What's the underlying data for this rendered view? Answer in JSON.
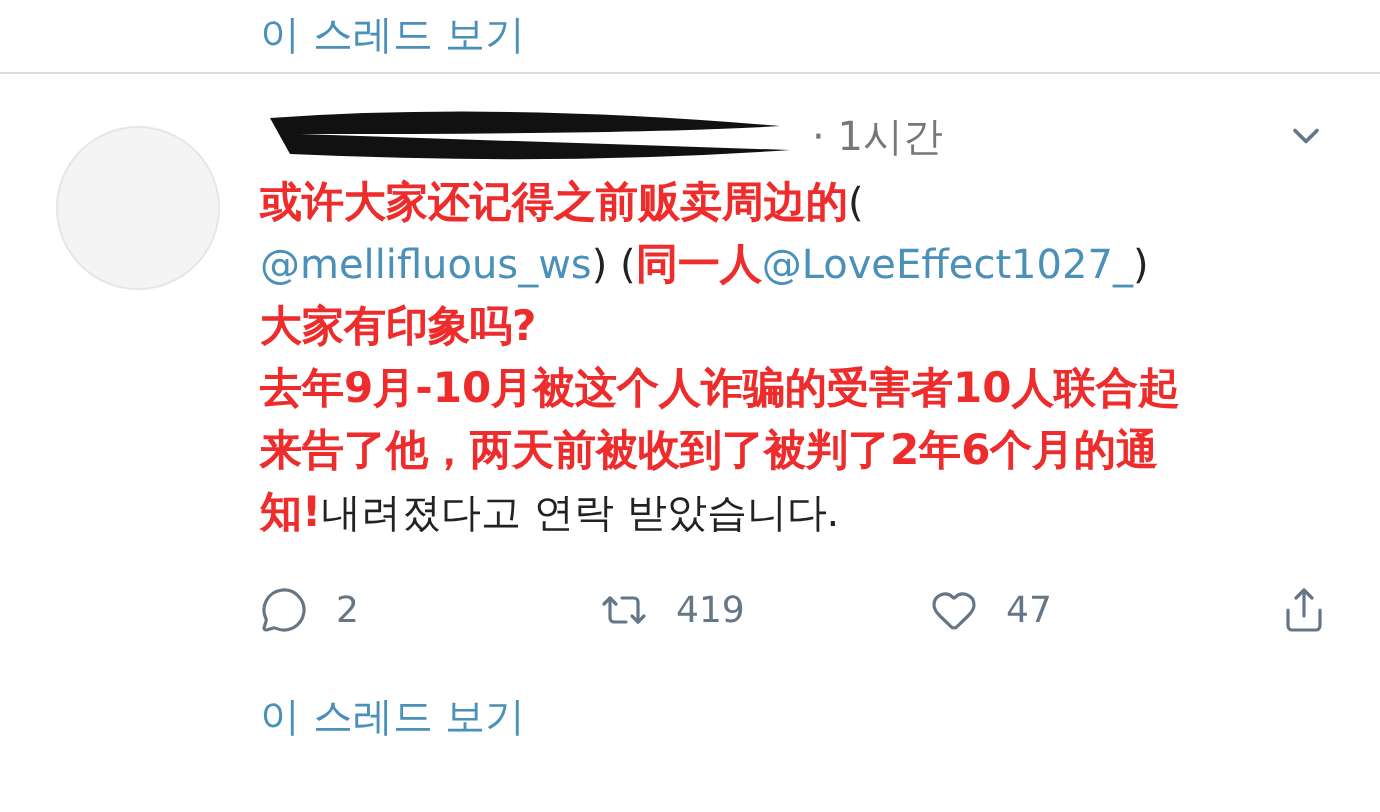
{
  "top_link": "이 스레드 보기",
  "tweet": {
    "header": {
      "time": "· 1시간"
    },
    "lines": [
      [
        {
          "kind": "annotation",
          "text": "或许大家还记得之前贩卖周边的"
        },
        {
          "kind": "text",
          "text": "("
        }
      ],
      [
        {
          "kind": "mention",
          "text": "@mellifluous_ws"
        },
        {
          "kind": "text",
          "text": ") ("
        },
        {
          "kind": "annotation",
          "text": "同一人"
        },
        {
          "kind": "mention",
          "text": "@LoveEffect1027_"
        },
        {
          "kind": "text",
          "text": ")"
        }
      ],
      [
        {
          "kind": "annotation",
          "text": "大家有印象吗?"
        }
      ],
      [
        {
          "kind": "annotation",
          "text": "去年9月-10月被这个人诈骗的受害者10人联合起"
        }
      ],
      [
        {
          "kind": "annotation",
          "text": "来告了他，两天前被收到了被判了2年6个月的通"
        }
      ],
      [
        {
          "kind": "annotation",
          "text": "知!"
        },
        {
          "kind": "text",
          "text": "내려졌다고 연락 받았습니다."
        }
      ]
    ],
    "actions": [
      {
        "kind": "reply",
        "count": "2"
      },
      {
        "kind": "retweet",
        "count": "419"
      },
      {
        "kind": "like",
        "count": "47"
      },
      {
        "kind": "share"
      }
    ]
  },
  "bottom_link": "이 스레드 보기"
}
